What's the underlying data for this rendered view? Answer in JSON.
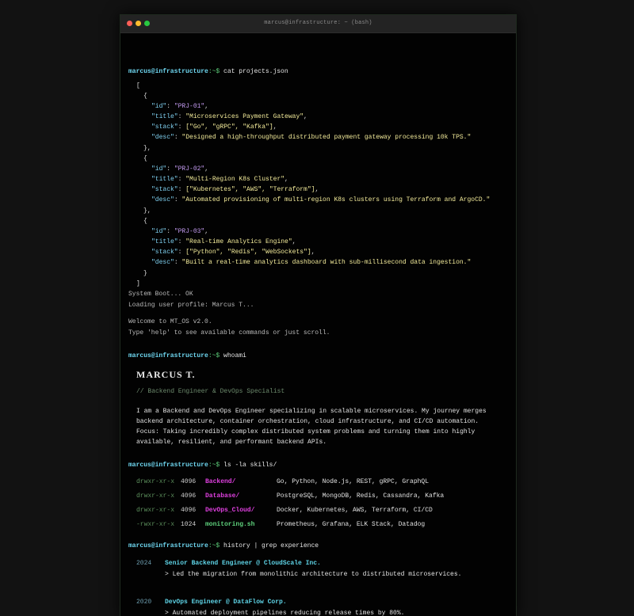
{
  "window": {
    "title": "marcus@infrastructure: ~ (bash)"
  },
  "prompt": {
    "user": "marcus@infrastructure",
    "path": ":~$"
  },
  "commands": {
    "cat": "cat projects.json",
    "whoami": "whoami",
    "ls": "ls -la skills/",
    "history": "history | grep experience"
  },
  "projects": [
    {
      "id": "\"PRJ-01\"",
      "title": "\"Microservices Payment Gateway\"",
      "stack": "[\"Go\", \"gRPC\", \"Kafka\"]",
      "desc": "\"Designed a high-throughput distributed payment gateway processing 10k TPS.\""
    },
    {
      "id": "\"PRJ-02\"",
      "title": "\"Multi-Region K8s Cluster\"",
      "stack": "[\"Kubernetes\", \"AWS\", \"Terraform\"]",
      "desc": "\"Automated provisioning of multi-region K8s clusters using Terraform and ArgoCD.\""
    },
    {
      "id": "\"PRJ-03\"",
      "title": "\"Real-time Analytics Engine\"",
      "stack": "[\"Python\", \"Redis\", \"WebSockets\"]",
      "desc": "\"Built a real-time analytics dashboard with sub-millisecond data ingestion.\""
    }
  ],
  "json_keys": {
    "id": "\"id\"",
    "title": "\"title\"",
    "stack": "\"stack\"",
    "desc": "\"desc\""
  },
  "boot": {
    "line1": "System Boot... OK",
    "line2": "Loading user profile: Marcus T...",
    "line3": "Welcome to MT_OS v2.0.",
    "line4": "Type 'help' to see available commands or just scroll."
  },
  "profile": {
    "name": "MARCUS T.",
    "subtitle": "// Backend Engineer & DevOps Specialist",
    "bio": [
      "I am a Backend and DevOps Engineer specializing in scalable microservices. My journey merges",
      "backend architecture, container orchestration, cloud infrastructure, and CI/CD automation.",
      "Focus: Taking incredibly complex distributed system problems and turning them into highly",
      "available, resilient, and performant backend APIs."
    ]
  },
  "skills": [
    {
      "perm": "drwxr-xr-x",
      "size": "4096",
      "name": "Backend/",
      "type": "dir",
      "desc": "Go, Python, Node.js, REST, gRPC, GraphQL"
    },
    {
      "perm": "drwxr-xr-x",
      "size": "4096",
      "name": "Database/",
      "type": "dir",
      "desc": "PostgreSQL, MongoDB, Redis, Cassandra, Kafka"
    },
    {
      "perm": "drwxr-xr-x",
      "size": "4096",
      "name": "DevOps_Cloud/",
      "type": "dir",
      "desc": "Docker, Kubernetes, AWS, Terraform, CI/CD"
    },
    {
      "perm": "-rwxr-xr-x",
      "size": "1024",
      "name": "monitoring.sh",
      "type": "file",
      "desc": "Prometheus, Grafana, ELK Stack, Datadog"
    }
  ],
  "experience": [
    {
      "year": "2024",
      "role": "Senior Backend Engineer @ CloudScale Inc.",
      "desc": "> Led the migration from monolithic architecture to distributed microservices."
    },
    {
      "year": "2020",
      "role": "DevOps Engineer @ DataFlow Corp.",
      "desc": "> Automated deployment pipelines reducing release times by 80%."
    }
  ],
  "colors": {
    "background": "#121212",
    "terminal": "#020202",
    "prompt_user": "#6fd8f2",
    "prompt_path": "#5ed17c",
    "json_key": "#7fd0f0",
    "json_string": "#f3eb9a",
    "json_id": "#c49bf1",
    "directory": "#e040e0",
    "executable": "#5ed17c",
    "role": "#5fd5e8"
  }
}
